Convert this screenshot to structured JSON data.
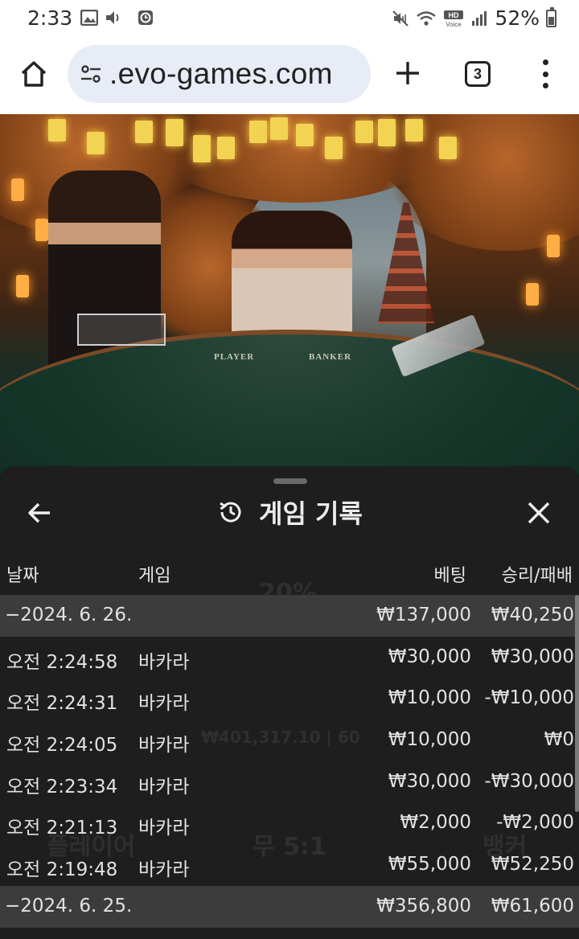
{
  "status_bar": {
    "time": "2:33",
    "battery": "52%"
  },
  "browser": {
    "url": ".evo-games.com",
    "tab_count": "3"
  },
  "video": {
    "table_labels": [
      "PLAYER",
      "BANKER"
    ]
  },
  "sheet": {
    "title": "게임 기록",
    "columns": {
      "date": "날짜",
      "game": "게임",
      "bet": "베팅",
      "win_loss": "승리/패배"
    },
    "background_overlay": {
      "percent": "20%",
      "balance_info": "₩401,317.10 | 60",
      "player": "플레이어",
      "tie": "무 5:1",
      "banker": "뱅커"
    },
    "rows": [
      {
        "type": "date",
        "date": "−2024. 6. 26.",
        "game": "",
        "bet": "₩137,000",
        "win_loss": "₩40,250"
      },
      {
        "type": "entry",
        "date": "오전 2:24:58",
        "game": "바카라",
        "bet": "₩30,000",
        "win_loss": "₩30,000"
      },
      {
        "type": "entry",
        "date": "오전 2:24:31",
        "game": "바카라",
        "bet": "₩10,000",
        "win_loss": "-₩10,000"
      },
      {
        "type": "entry",
        "date": "오전 2:24:05",
        "game": "바카라",
        "bet": "₩10,000",
        "win_loss": "₩0"
      },
      {
        "type": "entry",
        "date": "오전 2:23:34",
        "game": "바카라",
        "bet": "₩30,000",
        "win_loss": "-₩30,000"
      },
      {
        "type": "entry",
        "date": "오전 2:21:13",
        "game": "바카라",
        "bet": "₩2,000",
        "win_loss": "-₩2,000"
      },
      {
        "type": "entry",
        "date": "오전 2:19:48",
        "game": "바카라",
        "bet": "₩55,000",
        "win_loss": "₩52,250"
      },
      {
        "type": "date",
        "date": "−2024. 6. 25.",
        "game": "",
        "bet": "₩356,800",
        "win_loss": "₩61,600"
      }
    ]
  }
}
